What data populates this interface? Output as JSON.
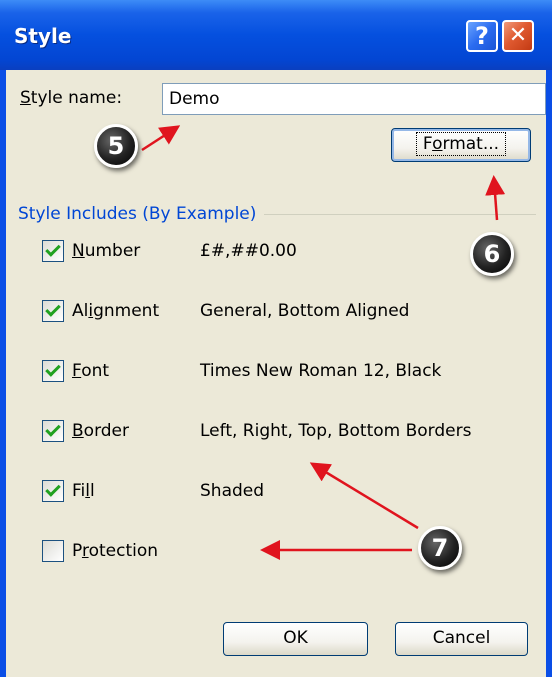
{
  "window": {
    "title": "Style",
    "help_glyph": "?",
    "close_glyph": "✕"
  },
  "style_name": {
    "label_accel": "S",
    "label_rest": "tyle name:",
    "value": "Demo"
  },
  "format_button": {
    "accel": "o",
    "pre": "F",
    "post": "rmat..."
  },
  "group": {
    "title": "Style Includes (By Example)",
    "items": [
      {
        "accel": "N",
        "rest": "umber",
        "checked": true,
        "desc": "£#,##0.00"
      },
      {
        "pre": "Al",
        "accel": "i",
        "rest": "gnment",
        "checked": true,
        "desc": "General, Bottom Aligned"
      },
      {
        "accel": "F",
        "rest": "ont",
        "checked": true,
        "desc": "Times New Roman 12, Black"
      },
      {
        "accel": "B",
        "rest": "order",
        "checked": true,
        "desc": "Left, Right, Top, Bottom Borders"
      },
      {
        "pre": "Fi",
        "accel": "l",
        "rest": "l",
        "checked": true,
        "desc": "Shaded"
      },
      {
        "pre": "P",
        "accel": "r",
        "rest": "otection",
        "checked": false,
        "desc": ""
      }
    ]
  },
  "buttons": {
    "ok": "OK",
    "cancel": "Cancel"
  },
  "callouts": {
    "c5": "5",
    "c6": "6",
    "c7": "7"
  },
  "colors": {
    "title_bar": "#0550df",
    "dialog_face": "#ece9d8",
    "group_title": "#0046d5",
    "arrow": "#e0141e",
    "check": "#21a121"
  }
}
